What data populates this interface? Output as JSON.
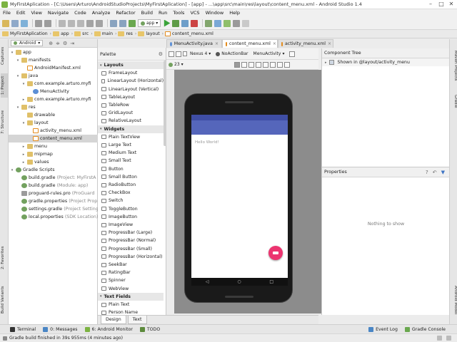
{
  "window": {
    "title": "MyFirstAplication - [C:\\Users\\Arturo\\AndroidStudioProjects\\MyFirstAplication] - [app] - ...\\app\\src\\main\\res\\layout\\content_menu.xml - Android Studio 1.4"
  },
  "menu": [
    "File",
    "Edit",
    "View",
    "Navigate",
    "Code",
    "Analyze",
    "Refactor",
    "Build",
    "Run",
    "Tools",
    "VCS",
    "Window",
    "Help"
  ],
  "toolbar": {
    "run_config": "app"
  },
  "breadcrumb": [
    "MyFirstAplication",
    "app",
    "src",
    "main",
    "res",
    "layout",
    "content_menu.xml"
  ],
  "project": {
    "view_selector": "Android",
    "tree": [
      {
        "label": "app",
        "depth": 0,
        "icon": "module",
        "arrow": "▾"
      },
      {
        "label": "manifests",
        "depth": 1,
        "icon": "folder",
        "arrow": "▾"
      },
      {
        "label": "AndroidManifest.xml",
        "depth": 2,
        "icon": "xml",
        "arrow": ""
      },
      {
        "label": "java",
        "depth": 1,
        "icon": "folder",
        "arrow": "▾"
      },
      {
        "label": "com.example.arturo.myfi",
        "depth": 2,
        "icon": "folder",
        "arrow": "▾"
      },
      {
        "label": "MenuActivity",
        "depth": 3,
        "icon": "class",
        "arrow": ""
      },
      {
        "label": "com.example.arturo.myfi",
        "depth": 2,
        "icon": "folder",
        "arrow": "▸"
      },
      {
        "label": "res",
        "depth": 1,
        "icon": "folder",
        "arrow": "▾"
      },
      {
        "label": "drawable",
        "depth": 2,
        "icon": "folder",
        "arrow": ""
      },
      {
        "label": "layout",
        "depth": 2,
        "icon": "folder",
        "arrow": "▾"
      },
      {
        "label": "activity_menu.xml",
        "depth": 3,
        "icon": "xml",
        "arrow": ""
      },
      {
        "label": "content_menu.xml",
        "depth": 3,
        "icon": "xml",
        "arrow": "",
        "selected": true
      },
      {
        "label": "menu",
        "depth": 2,
        "icon": "folder",
        "arrow": "▸"
      },
      {
        "label": "mipmap",
        "depth": 2,
        "icon": "folder",
        "arrow": "▸"
      },
      {
        "label": "values",
        "depth": 2,
        "icon": "folder",
        "arrow": "▸"
      },
      {
        "label": "Gradle Scripts",
        "depth": 0,
        "icon": "gradle",
        "arrow": "▾"
      },
      {
        "label": "build.gradle",
        "depth": 1,
        "icon": "gradle",
        "arrow": "",
        "hint": "(Project: MyFirstA"
      },
      {
        "label": "build.gradle",
        "depth": 1,
        "icon": "gradle",
        "arrow": "",
        "hint": "(Module: app)"
      },
      {
        "label": "proguard-rules.pro",
        "depth": 1,
        "icon": "file",
        "arrow": "",
        "hint": "(ProGuard"
      },
      {
        "label": "gradle.properties",
        "depth": 1,
        "icon": "gradle",
        "arrow": "",
        "hint": "(Project Prop"
      },
      {
        "label": "settings.gradle",
        "depth": 1,
        "icon": "gradle",
        "arrow": "",
        "hint": "(Project Setting"
      },
      {
        "label": "local.properties",
        "depth": 1,
        "icon": "gradle",
        "arrow": "",
        "hint": "(SDK Location)"
      }
    ]
  },
  "palette": {
    "title": "Palette",
    "items": [
      {
        "label": "Layouts",
        "category": true
      },
      {
        "label": "FrameLayout"
      },
      {
        "label": "LinearLayout (Horizontal)"
      },
      {
        "label": "LinearLayout (Vertical)"
      },
      {
        "label": "TableLayout"
      },
      {
        "label": "TableRow"
      },
      {
        "label": "GridLayout"
      },
      {
        "label": "RelativeLayout"
      },
      {
        "label": "Widgets",
        "category": true
      },
      {
        "label": "Plain TextView"
      },
      {
        "label": "Large Text"
      },
      {
        "label": "Medium Text"
      },
      {
        "label": "Small Text"
      },
      {
        "label": "Button"
      },
      {
        "label": "Small Button"
      },
      {
        "label": "RadioButton"
      },
      {
        "label": "CheckBox"
      },
      {
        "label": "Switch"
      },
      {
        "label": "ToggleButton"
      },
      {
        "label": "ImageButton"
      },
      {
        "label": "ImageView"
      },
      {
        "label": "ProgressBar (Large)"
      },
      {
        "label": "ProgressBar (Normal)"
      },
      {
        "label": "ProgressBar (Small)"
      },
      {
        "label": "ProgressBar (Horizontal)"
      },
      {
        "label": "SeekBar"
      },
      {
        "label": "RatingBar"
      },
      {
        "label": "Spinner"
      },
      {
        "label": "WebView"
      },
      {
        "label": "Text Fields",
        "category": true
      },
      {
        "label": "Plain Text"
      },
      {
        "label": "Person Name"
      }
    ]
  },
  "editor_tabs": [
    {
      "label": "MenuActivity.java",
      "active": false
    },
    {
      "label": "content_menu.xml",
      "active": true
    },
    {
      "label": "activity_menu.xml",
      "active": false
    }
  ],
  "designer": {
    "device": "Nexus 4",
    "theme": "NoActionBar",
    "activity": "MenuActivity",
    "api": "23",
    "hello_text": "Hello World!"
  },
  "design_tabs": [
    "Design",
    "Text"
  ],
  "component_tree": {
    "title": "Component Tree",
    "root": "Shown in @layout/activity_menu"
  },
  "properties": {
    "title": "Properties",
    "empty_text": "Nothing to show"
  },
  "left_strip": [
    "Captures",
    "1: Project",
    "7: Structure",
    "2: Favorites",
    "Build Variants"
  ],
  "right_strip": [
    "Maven Projects",
    "Gradle",
    "Android Model"
  ],
  "bottom_tools": [
    {
      "label": "Terminal"
    },
    {
      "label": "0: Messages"
    },
    {
      "label": "6: Android Monitor"
    },
    {
      "label": "TODO"
    }
  ],
  "bottom_right_tools": [
    {
      "label": "Event Log"
    },
    {
      "label": "Gradle Console"
    }
  ],
  "status": "Gradle build finished in 39s 955ms (4 minutes ago)",
  "colors": {
    "status_bar": "#3f4ea5",
    "app_bar": "#5566bb",
    "fab": "#ec3470"
  }
}
